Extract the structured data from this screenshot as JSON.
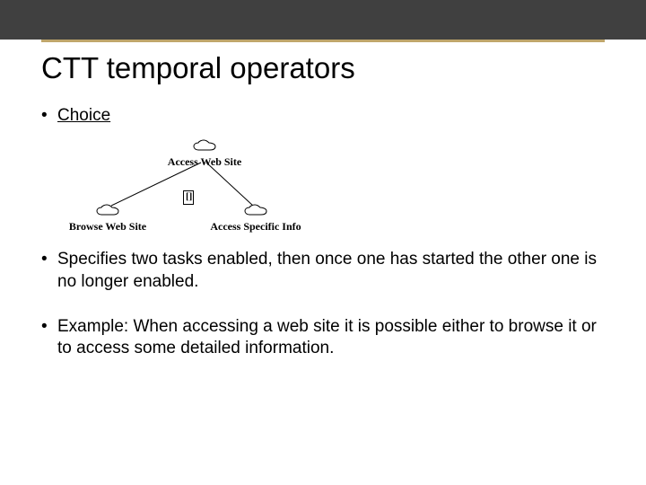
{
  "title": "CTT temporal operators",
  "bullets": {
    "choice_label": "Choice",
    "spec": "Specifies two tasks enabled, then once one has started the other one is no longer enabled.",
    "example": "Example: When accessing a web site it is possible either to browse it or to access some detailed information."
  },
  "diagram": {
    "root": "Access Web Site",
    "left": "Browse Web Site",
    "right": "Access Specific Info",
    "operator": "[]",
    "icon_name": "cloud-task-icon"
  }
}
